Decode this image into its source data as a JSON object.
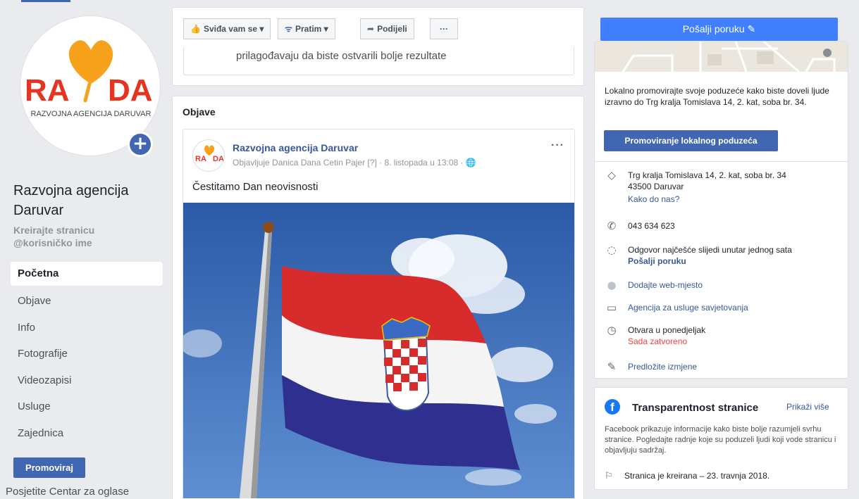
{
  "left": {
    "logo": {
      "text_left": "RA",
      "text_right": "DA",
      "subtitle": "RAZVOJNA AGENCIJA DARUVAR"
    },
    "page_name": "Razvojna agencija Daruvar",
    "handle_line1": "Kreirajte stranicu",
    "handle_line2": "@korisničko ime",
    "nav": [
      {
        "label": "Početna",
        "active": true
      },
      {
        "label": "Objave"
      },
      {
        "label": "Info"
      },
      {
        "label": "Fotografije"
      },
      {
        "label": "Videozapisi"
      },
      {
        "label": "Usluge"
      },
      {
        "label": "Zajednica"
      }
    ],
    "promote_label": "Promoviraj",
    "ad_center_label": "Posjetite Centar za oglase"
  },
  "actionbar": {
    "like_label": "Sviđa vam se ▾",
    "follow_label": "Pratim ▾",
    "share_label": "Podijeli",
    "more_label": "···",
    "promo_note": "prilagođavaju da biste ostvarili bolje rezultate"
  },
  "posts": {
    "section_title": "Objave",
    "post": {
      "author": "Razvojna agencija Daruvar",
      "meta": "Objavljuje Danica Dana Cetin Pajer [?] · 8. listopada u 13:08 ·",
      "text": "Čestitamo Dan neovisnosti",
      "more": "···"
    }
  },
  "right": {
    "send_message_label": "Pošalji poruku",
    "promo_text": "Lokalno promovirajte svoje poduzeće kako biste doveli ljude izravno do Trg kralja Tomislava 14, 2. kat, soba br. 34.",
    "local_promo_button": "Promoviranje lokalnog poduzeća",
    "address_line1": "Trg kralja Tomislava 14, 2. kat, soba br. 34",
    "address_line2": "43500 Daruvar",
    "directions": "Kako do nas?",
    "phone": "043 634 623",
    "response_text": "Odgovor najčešće slijedi unutar jednog sata",
    "response_link": "Pošalji poruku",
    "website": "Dodajte web-mjesto",
    "category": "Agencija za usluge savjetovanja",
    "hours": "Otvara u ponedjeljak",
    "status": "Sada zatvoreno",
    "suggest": "Predložite izmjene"
  },
  "transparency": {
    "title": "Transparentnost stranice",
    "more": "Prikaži više",
    "description": "Facebook prikazuje informacije kako biste bolje razumjeli svrhu stranice. Pogledajte radnje koje su poduzeli ljudi koji vode stranicu i objavljuju sadržaj.",
    "created": "Stranica je kreirana – 23. travnja 2018."
  },
  "colors": {
    "brand_blue": "#4267b2",
    "messenger_blue": "#4080ff",
    "logo_orange": "#f7a21b",
    "logo_red": "#e63322",
    "closed_red": "#fa3e3e"
  }
}
